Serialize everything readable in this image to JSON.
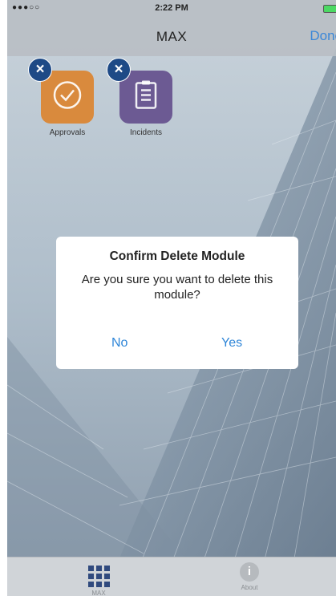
{
  "status_bar": {
    "signal": "●●●○○",
    "time": "2:22 PM"
  },
  "nav": {
    "title": "MAX",
    "done_label": "Done"
  },
  "modules": [
    {
      "label": "Approvals",
      "icon": "checkmark-circle-icon",
      "color": "#d98a3d"
    },
    {
      "label": "Incidents",
      "icon": "clipboard-list-icon",
      "color": "#6c5a93"
    }
  ],
  "remove_glyph": "×",
  "dialog": {
    "title": "Confirm Delete Module",
    "message": "Are you sure you want to delete this module?",
    "no_label": "No",
    "yes_label": "Yes"
  },
  "tabbar": {
    "tabs": [
      {
        "label": "MAX",
        "icon": "grid-icon",
        "active": true
      },
      {
        "label": "About",
        "icon": "info-icon",
        "active": false
      }
    ],
    "info_glyph": "i"
  },
  "colors": {
    "accent": "#2f86d8",
    "tab_active": "#304a7e"
  }
}
